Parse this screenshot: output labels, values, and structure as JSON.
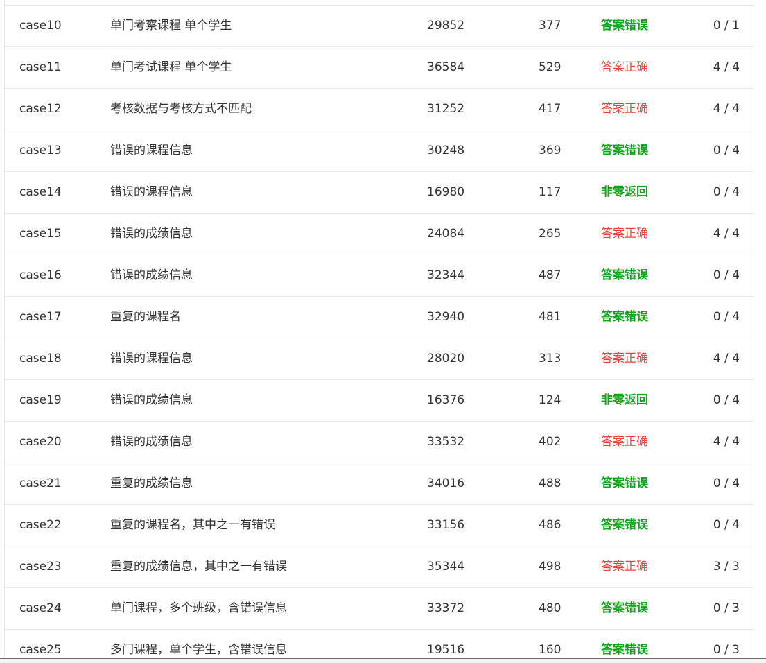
{
  "colors": {
    "answer_wrong": "#12a51e",
    "answer_correct": "#f2463c",
    "text": "#333333",
    "row_border": "#eaeaea"
  },
  "rows": [
    {
      "case": "case10",
      "desc": "单门考察课程 单个学生",
      "time": "29852",
      "mem": "377",
      "status": "答案错误",
      "score": "0 / 1"
    },
    {
      "case": "case11",
      "desc": "单门考试课程 单个学生",
      "time": "36584",
      "mem": "529",
      "status": "答案正确",
      "score": "4 / 4"
    },
    {
      "case": "case12",
      "desc": "考核数据与考核方式不匹配",
      "time": "31252",
      "mem": "417",
      "status": "答案正确",
      "score": "4 / 4"
    },
    {
      "case": "case13",
      "desc": "错误的课程信息",
      "time": "30248",
      "mem": "369",
      "status": "答案错误",
      "score": "0 / 4"
    },
    {
      "case": "case14",
      "desc": "错误的课程信息",
      "time": "16980",
      "mem": "117",
      "status": "非零返回",
      "score": "0 / 4"
    },
    {
      "case": "case15",
      "desc": "错误的成绩信息",
      "time": "24084",
      "mem": "265",
      "status": "答案正确",
      "score": "4 / 4"
    },
    {
      "case": "case16",
      "desc": "错误的成绩信息",
      "time": "32344",
      "mem": "487",
      "status": "答案错误",
      "score": "0 / 4"
    },
    {
      "case": "case17",
      "desc": "重复的课程名",
      "time": "32940",
      "mem": "481",
      "status": "答案错误",
      "score": "0 / 4"
    },
    {
      "case": "case18",
      "desc": "错误的课程信息",
      "time": "28020",
      "mem": "313",
      "status": "答案正确",
      "score": "4 / 4"
    },
    {
      "case": "case19",
      "desc": "错误的成绩信息",
      "time": "16376",
      "mem": "124",
      "status": "非零返回",
      "score": "0 / 4"
    },
    {
      "case": "case20",
      "desc": "错误的成绩信息",
      "time": "33532",
      "mem": "402",
      "status": "答案正确",
      "score": "4 / 4"
    },
    {
      "case": "case21",
      "desc": "重复的成绩信息",
      "time": "34016",
      "mem": "488",
      "status": "答案错误",
      "score": "0 / 4"
    },
    {
      "case": "case22",
      "desc": "重复的课程名，其中之一有错误",
      "time": "33156",
      "mem": "486",
      "status": "答案错误",
      "score": "0 / 4"
    },
    {
      "case": "case23",
      "desc": "重复的成绩信息，其中之一有错误",
      "time": "35344",
      "mem": "498",
      "status": "答案正确",
      "score": "3 / 3"
    },
    {
      "case": "case24",
      "desc": "单门课程，多个班级，含错误信息",
      "time": "33372",
      "mem": "480",
      "status": "答案错误",
      "score": "0 / 3"
    },
    {
      "case": "case25",
      "desc": "多门课程，单个学生，含错误信息",
      "time": "19516",
      "mem": "160",
      "status": "答案错误",
      "score": "0 / 3"
    }
  ]
}
